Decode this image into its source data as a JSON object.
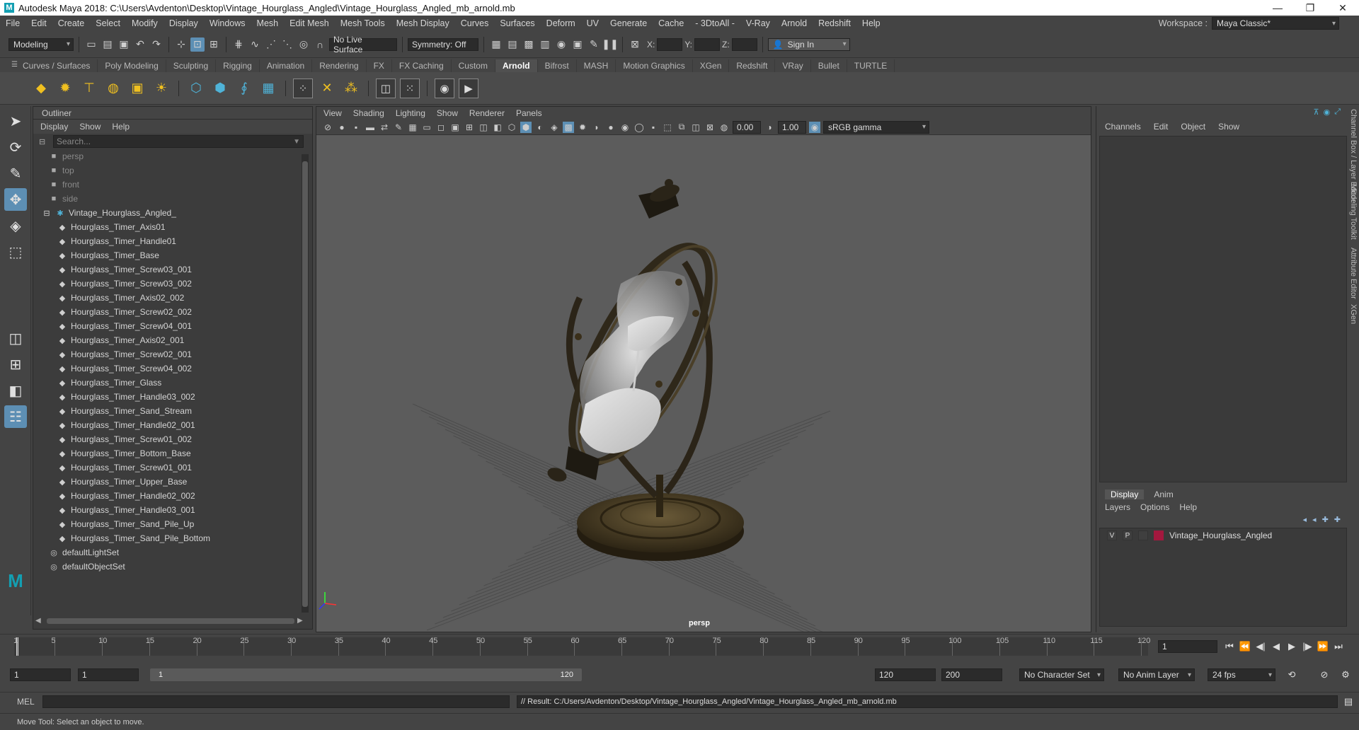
{
  "titlebar": {
    "title": "Autodesk Maya 2018: C:\\Users\\Avdenton\\Desktop\\Vintage_Hourglass_Angled\\Vintage_Hourglass_Angled_mb_arnold.mb"
  },
  "menubar": {
    "items": [
      "File",
      "Edit",
      "Create",
      "Select",
      "Modify",
      "Display",
      "Windows",
      "Mesh",
      "Edit Mesh",
      "Mesh Tools",
      "Mesh Display",
      "Curves",
      "Surfaces",
      "Deform",
      "UV",
      "Generate",
      "Cache",
      "- 3DtoAll -",
      "V-Ray",
      "Arnold",
      "Redshift",
      "Help"
    ],
    "workspace_label": "Workspace :",
    "workspace_value": "Maya Classic*"
  },
  "statusline": {
    "mode": "Modeling",
    "live_surface": "No Live Surface",
    "symmetry": "Symmetry: Off",
    "x_label": "X:",
    "y_label": "Y:",
    "z_label": "Z:",
    "sign_in": "Sign In"
  },
  "shelf": {
    "tabs": [
      "Curves / Surfaces",
      "Poly Modeling",
      "Sculpting",
      "Rigging",
      "Animation",
      "Rendering",
      "FX",
      "FX Caching",
      "Custom",
      "Arnold",
      "Bifrost",
      "MASH",
      "Motion Graphics",
      "XGen",
      "Redshift",
      "VRay",
      "Bullet",
      "TURTLE"
    ],
    "active_tab": "Arnold"
  },
  "outliner": {
    "title": "Outliner",
    "menu": [
      "Display",
      "Show",
      "Help"
    ],
    "search_placeholder": "Search...",
    "cameras": [
      "persp",
      "top",
      "front",
      "side"
    ],
    "group": "Vintage_Hourglass_Angled_",
    "children": [
      "Hourglass_Timer_Axis01",
      "Hourglass_Timer_Handle01",
      "Hourglass_Timer_Base",
      "Hourglass_Timer_Screw03_001",
      "Hourglass_Timer_Screw03_002",
      "Hourglass_Timer_Axis02_002",
      "Hourglass_Timer_Screw02_002",
      "Hourglass_Timer_Screw04_001",
      "Hourglass_Timer_Axis02_001",
      "Hourglass_Timer_Screw02_001",
      "Hourglass_Timer_Screw04_002",
      "Hourglass_Timer_Glass",
      "Hourglass_Timer_Handle03_002",
      "Hourglass_Timer_Sand_Stream",
      "Hourglass_Timer_Handle02_001",
      "Hourglass_Timer_Screw01_002",
      "Hourglass_Timer_Bottom_Base",
      "Hourglass_Timer_Screw01_001",
      "Hourglass_Timer_Upper_Base",
      "Hourglass_Timer_Handle02_002",
      "Hourglass_Timer_Handle03_001",
      "Hourglass_Timer_Sand_Pile_Up",
      "Hourglass_Timer_Sand_Pile_Bottom"
    ],
    "sets": [
      "defaultLightSet",
      "defaultObjectSet"
    ]
  },
  "viewport": {
    "menu": [
      "View",
      "Shading",
      "Lighting",
      "Show",
      "Renderer",
      "Panels"
    ],
    "exposure": "0.00",
    "gamma": "1.00",
    "color_space": "sRGB gamma",
    "camera_label": "persp"
  },
  "channelbox": {
    "menu": [
      "Channels",
      "Edit",
      "Object",
      "Show"
    ],
    "layer_tabs": [
      "Display",
      "Anim"
    ],
    "layer_menu": [
      "Layers",
      "Options",
      "Help"
    ],
    "layer": {
      "v": "V",
      "p": "P",
      "name": "Vintage_Hourglass_Angled",
      "color": "#a3183e"
    },
    "side_tabs": [
      "Channel Box / Layer Editor",
      "Modeling Toolkit",
      "Attribute Editor",
      "XGen"
    ]
  },
  "timeline": {
    "ticks": [
      "1",
      "5",
      "10",
      "15",
      "20",
      "25",
      "30",
      "35",
      "40",
      "45",
      "50",
      "55",
      "60",
      "65",
      "70",
      "75",
      "80",
      "85",
      "90",
      "95",
      "100",
      "105",
      "110",
      "115",
      "120"
    ],
    "current_frame": "1"
  },
  "range": {
    "start": "1",
    "anim_start": "1",
    "slider_start": "1",
    "slider_end": "120",
    "anim_end": "120",
    "end": "200",
    "character_set": "No Character Set",
    "anim_layer": "No Anim Layer",
    "fps": "24 fps"
  },
  "cmdline": {
    "label": "MEL",
    "result": "// Result: C:/Users/Avdenton/Desktop/Vintage_Hourglass_Angled/Vintage_Hourglass_Angled_mb_arnold.mb"
  },
  "helpline": {
    "text": "Move Tool: Select an object to move."
  }
}
